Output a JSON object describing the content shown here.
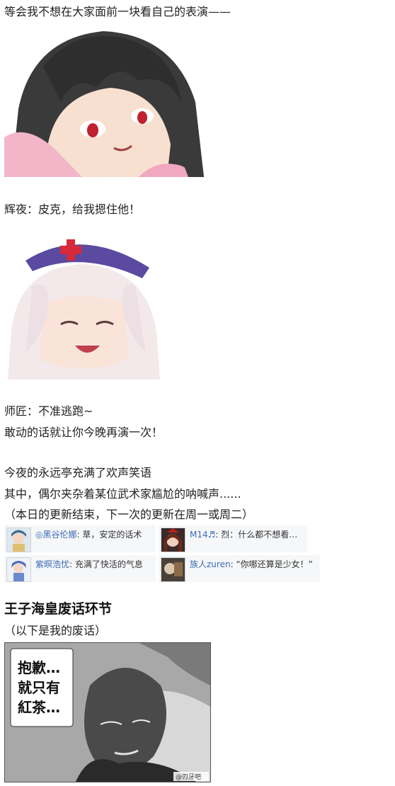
{
  "lines": {
    "l1": "等会我不想在大家面前一块看自己的表演——",
    "l2": "辉夜：皮克，给我摁住他！",
    "l3": "师匠：不准逃跑~",
    "l4": "敢动的话就让你今晚再演一次！",
    "l5": "今夜的永远亭充满了欢声笑语",
    "l6": "其中，偶尔夹杂着某位武术家尴尬的呐喊声......",
    "l7": "（本日的更新结束，下一次的更新在周一或周二）"
  },
  "comments": [
    {
      "user": "◎黑谷伦娜",
      "text": ": 草，安定的话术"
    },
    {
      "user": "M14♬",
      "text": ": 烈：什么都不想看…"
    },
    {
      "user": "紫暝浩忧",
      "text": ": 充满了快活的气息"
    },
    {
      "user": "族人zuren",
      "text": ": “你哪还算是少女！”"
    }
  ],
  "section": {
    "heading": "王子海皇废话环节",
    "sub": "（以下是我的废话）"
  },
  "manga": {
    "bubble_line1": "抱歉…",
    "bubble_line2": "就只有",
    "bubble_line3": "紅茶…",
    "watermark": "@刃牙吧"
  }
}
